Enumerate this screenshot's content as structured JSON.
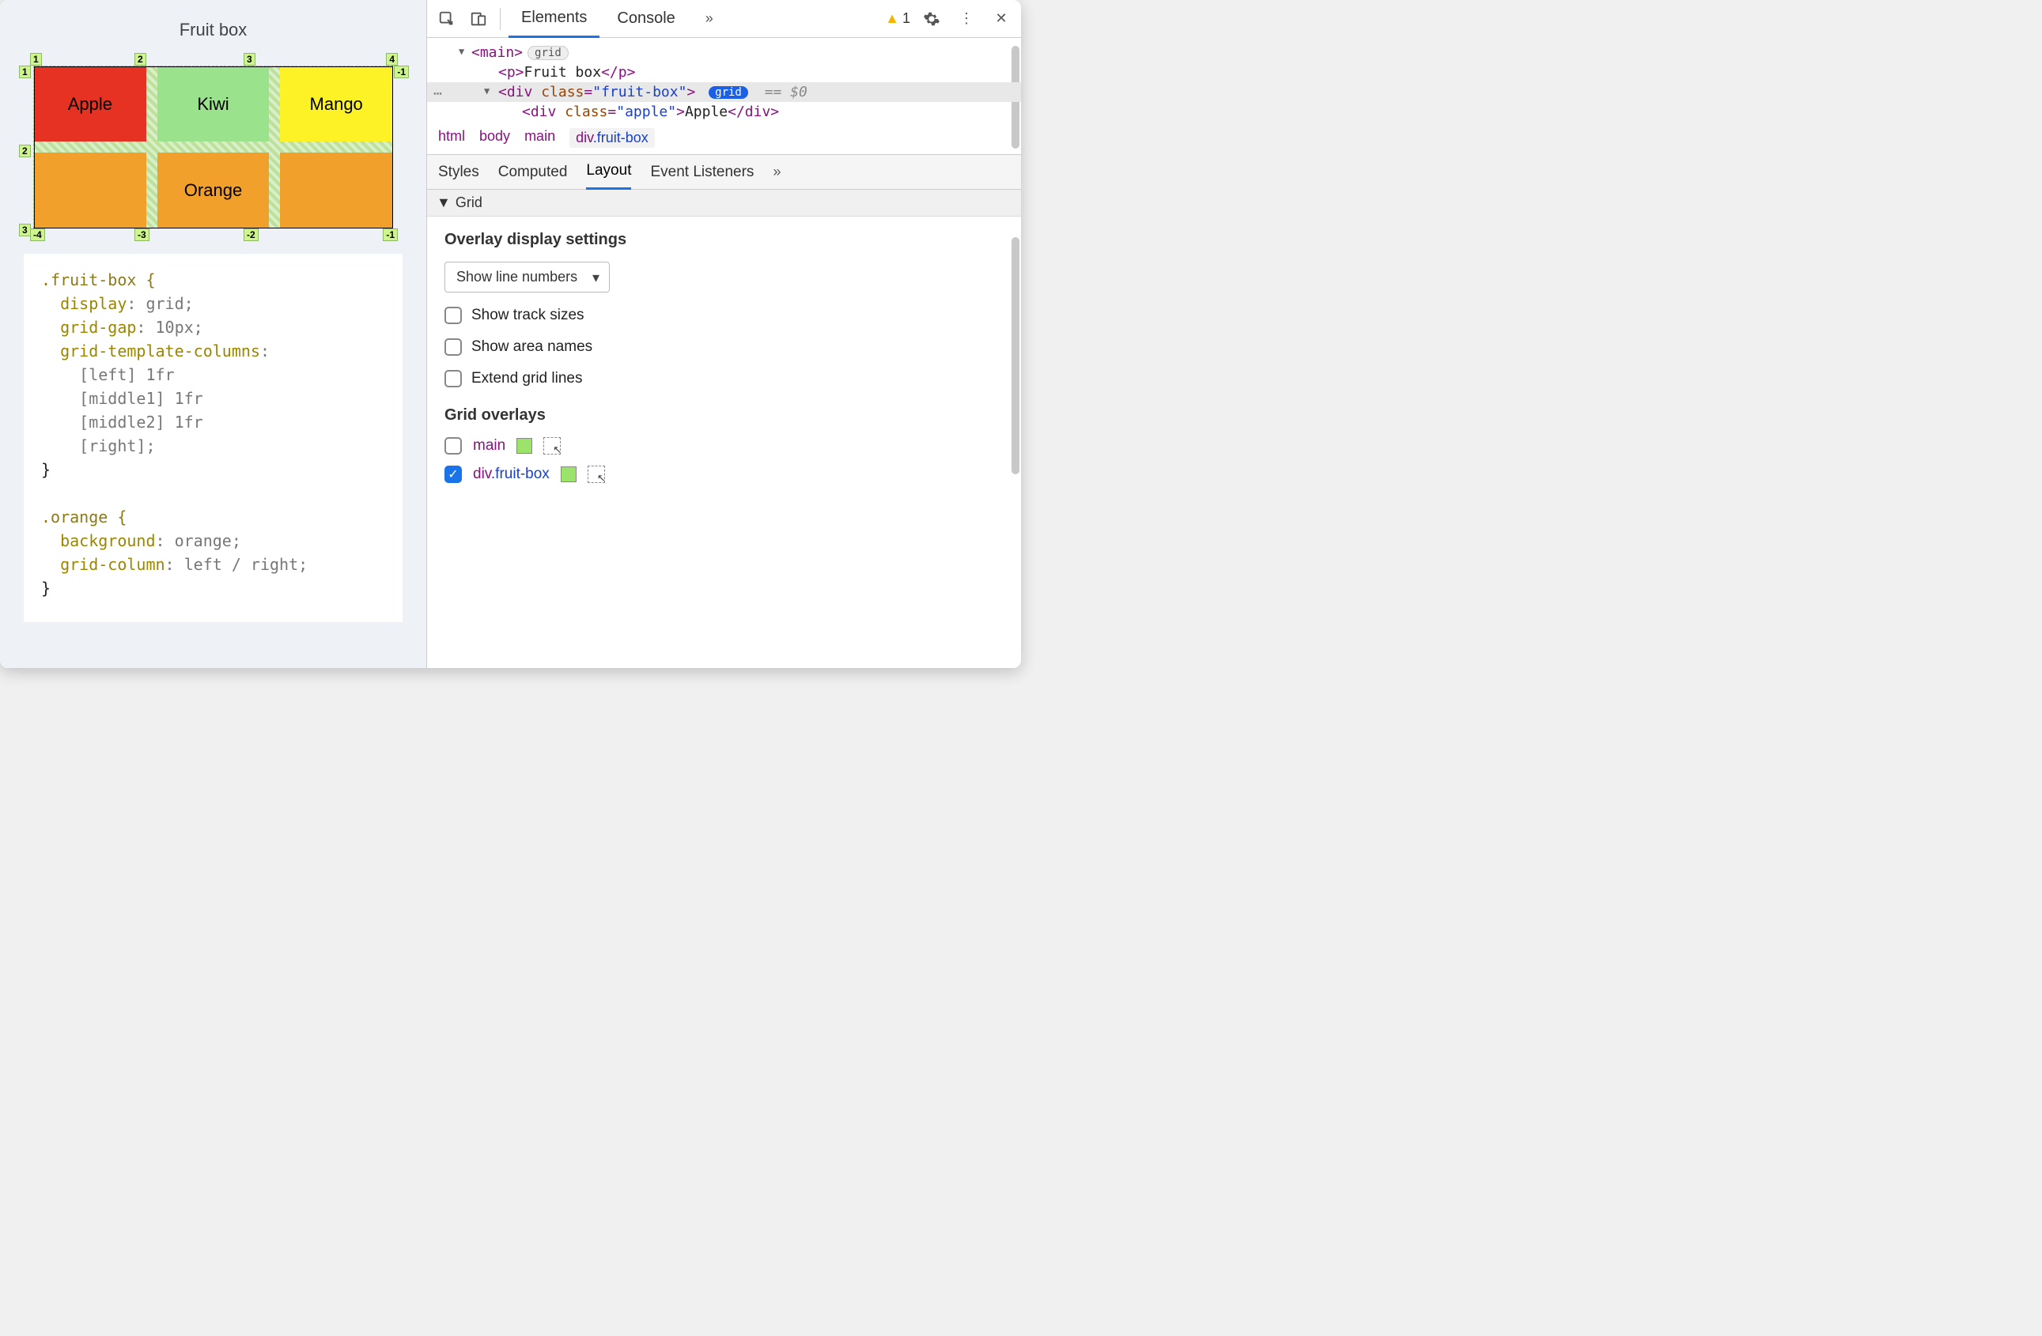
{
  "page": {
    "title": "Fruit box",
    "cells": {
      "apple": "Apple",
      "kiwi": "Kiwi",
      "mango": "Mango",
      "orange": "Orange"
    },
    "gridNumbers": {
      "top": [
        "1",
        "2",
        "3",
        "4"
      ],
      "leftTop": "1",
      "rightTop": "-1",
      "leftMid": "2",
      "leftBot": "3",
      "bottom": [
        "-4",
        "-3",
        "-2",
        "-1"
      ]
    },
    "css": {
      "sel1": ".fruit-box {",
      "l1a": "  display",
      "l1b": ": grid;",
      "l2a": "  grid-gap",
      "l2b": ": 10px;",
      "l3a": "  grid-template-columns",
      "l3b": ":",
      "l4": "    [left] 1fr",
      "l5": "    [middle1] 1fr",
      "l6": "    [middle2] 1fr",
      "l7": "    [right];",
      "close1": "}",
      "blank": "",
      "sel2": ".orange {",
      "l8a": "  background",
      "l8b": ": orange;",
      "l9a": "  grid-column",
      "l9b": ": left / right;",
      "close2": "}"
    }
  },
  "devtools": {
    "tabs": {
      "elements": "Elements",
      "console": "Console"
    },
    "more": "»",
    "warnCount": "1",
    "dom": {
      "main_open": "<main>",
      "main_badge": "grid",
      "p_open": "<p>",
      "p_text": "Fruit box",
      "p_close": "</p>",
      "div_open_tag": "div",
      "div_attr_name": "class",
      "div_attr_val": "\"fruit-box\"",
      "div_badge": "grid",
      "sel_hint": "== $0",
      "apple_open_tag": "div",
      "apple_attr_name": "class",
      "apple_attr_val": "\"apple\"",
      "apple_text": "Apple",
      "apple_close": "</div>"
    },
    "breadcrumbs": [
      "html",
      "body",
      "main"
    ],
    "breadcrumb_current_el": "div",
    "breadcrumb_current_cls": ".fruit-box",
    "panelTabs": {
      "styles": "Styles",
      "computed": "Computed",
      "layout": "Layout",
      "events": "Event Listeners"
    },
    "gridSection": "Grid",
    "overlaySettings": {
      "heading": "Overlay display settings",
      "select": "Show line numbers",
      "trackSizes": "Show track sizes",
      "areaNames": "Show area names",
      "extend": "Extend grid lines"
    },
    "gridOverlays": {
      "heading": "Grid overlays",
      "items": [
        {
          "label_el": "main",
          "checked": false,
          "swatch": "#9be36a"
        },
        {
          "label_el": "div",
          "label_cls": ".fruit-box",
          "checked": true,
          "swatch": "#9be36a"
        }
      ]
    }
  }
}
